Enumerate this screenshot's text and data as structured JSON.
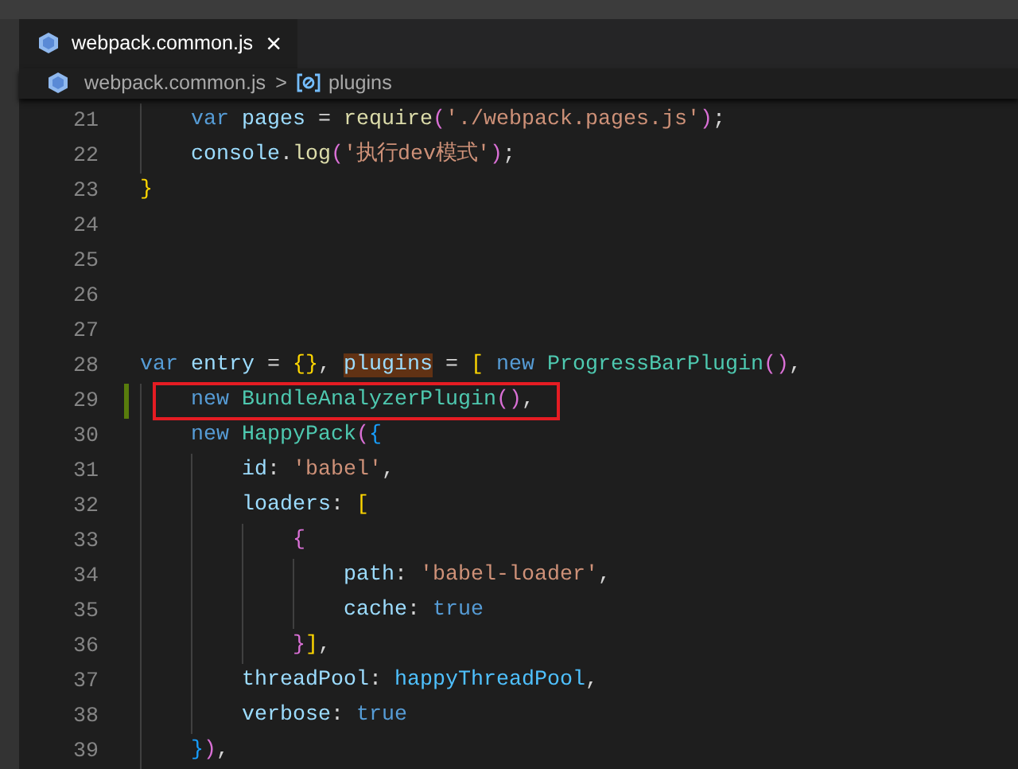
{
  "tab": {
    "label": "webpack.common.js",
    "close": "×",
    "selected": true
  },
  "breadcrumb": {
    "file": "webpack.common.js",
    "separator": ">",
    "symbol": "plugins"
  },
  "lines": [
    {
      "number": "21",
      "modified": false,
      "boxed": false,
      "tokens": [
        {
          "text": "    var ",
          "kind": "keyword"
        },
        {
          "text": "pages",
          "kind": "variable"
        },
        {
          "text": " = ",
          "kind": "plain"
        },
        {
          "text": "require",
          "kind": "function"
        },
        {
          "text": "(",
          "kind": "bracket2"
        },
        {
          "text": "'./webpack.pages.js'",
          "kind": "string"
        },
        {
          "text": ")",
          "kind": "bracket2"
        },
        {
          "text": ";",
          "kind": "plain"
        }
      ]
    },
    {
      "number": "22",
      "modified": false,
      "boxed": false,
      "tokens": [
        {
          "text": "    console",
          "kind": "variable"
        },
        {
          "text": ".",
          "kind": "plain"
        },
        {
          "text": "log",
          "kind": "function"
        },
        {
          "text": "(",
          "kind": "bracket2"
        },
        {
          "text": "'执行dev模式'",
          "kind": "string"
        },
        {
          "text": ")",
          "kind": "bracket2"
        },
        {
          "text": ";",
          "kind": "plain"
        }
      ]
    },
    {
      "number": "23",
      "modified": false,
      "boxed": false,
      "tokens": [
        {
          "text": "}",
          "kind": "bracket1"
        }
      ]
    },
    {
      "number": "24",
      "modified": false,
      "boxed": false
    },
    {
      "number": "25",
      "modified": false,
      "boxed": false
    },
    {
      "number": "26",
      "modified": false,
      "boxed": false
    },
    {
      "number": "27",
      "modified": false,
      "boxed": false
    },
    {
      "number": "28",
      "modified": false,
      "boxed": false,
      "tokens": [
        {
          "text": "var ",
          "kind": "keyword"
        },
        {
          "text": "entry",
          "kind": "variable"
        },
        {
          "text": " = ",
          "kind": "plain"
        },
        {
          "text": "{}",
          "kind": "bracket1"
        },
        {
          "text": ", ",
          "kind": "plain"
        },
        {
          "text": "plugins",
          "kind": "highlight"
        },
        {
          "text": " = ",
          "kind": "plain"
        },
        {
          "text": "[ ",
          "kind": "bracket1"
        },
        {
          "text": "new ",
          "kind": "keyword"
        },
        {
          "text": "ProgressBarPlugin",
          "kind": "class"
        },
        {
          "text": "()",
          "kind": "bracket2"
        },
        {
          "text": ",",
          "kind": "plain"
        }
      ]
    },
    {
      "number": "29",
      "modified": true,
      "boxed": true,
      "tokens": [
        {
          "text": "    new ",
          "kind": "keyword"
        },
        {
          "text": "BundleAnalyzerPlugin",
          "kind": "class"
        },
        {
          "text": "()",
          "kind": "bracket2"
        },
        {
          "text": ",",
          "kind": "plain"
        }
      ]
    },
    {
      "number": "30",
      "modified": false,
      "boxed": false,
      "tokens": [
        {
          "text": "    new ",
          "kind": "keyword"
        },
        {
          "text": "HappyPack",
          "kind": "class"
        },
        {
          "text": "(",
          "kind": "bracket2"
        },
        {
          "text": "{",
          "kind": "bracket3"
        }
      ]
    },
    {
      "number": "31",
      "modified": false,
      "boxed": false,
      "tokens": [
        {
          "text": "        id",
          "kind": "variable"
        },
        {
          "text": ": ",
          "kind": "plain"
        },
        {
          "text": "'babel'",
          "kind": "string"
        },
        {
          "text": ",",
          "kind": "plain"
        }
      ]
    },
    {
      "number": "32",
      "modified": false,
      "boxed": false,
      "tokens": [
        {
          "text": "        loaders",
          "kind": "variable"
        },
        {
          "text": ": ",
          "kind": "plain"
        },
        {
          "text": "[",
          "kind": "bracket1"
        }
      ]
    },
    {
      "number": "33",
      "modified": false,
      "boxed": false,
      "tokens": [
        {
          "text": "            {",
          "kind": "bracket2"
        }
      ]
    },
    {
      "number": "34",
      "modified": false,
      "boxed": false,
      "tokens": [
        {
          "text": "                path",
          "kind": "variable"
        },
        {
          "text": ": ",
          "kind": "plain"
        },
        {
          "text": "'babel-loader'",
          "kind": "string"
        },
        {
          "text": ",",
          "kind": "plain"
        }
      ]
    },
    {
      "number": "35",
      "modified": false,
      "boxed": false,
      "tokens": [
        {
          "text": "                cache",
          "kind": "variable"
        },
        {
          "text": ": ",
          "kind": "plain"
        },
        {
          "text": "true",
          "kind": "keyword"
        }
      ]
    },
    {
      "number": "36",
      "modified": false,
      "boxed": false,
      "tokens": [
        {
          "text": "            }",
          "kind": "bracket2"
        },
        {
          "text": "]",
          "kind": "bracket1"
        },
        {
          "text": ",",
          "kind": "plain"
        }
      ]
    },
    {
      "number": "37",
      "modified": false,
      "boxed": false,
      "tokens": [
        {
          "text": "        threadPool",
          "kind": "variable"
        },
        {
          "text": ": ",
          "kind": "plain"
        },
        {
          "text": "happyThreadPool",
          "kind": "constant"
        },
        {
          "text": ",",
          "kind": "plain"
        }
      ]
    },
    {
      "number": "38",
      "modified": false,
      "boxed": false,
      "tokens": [
        {
          "text": "        verbose",
          "kind": "variable"
        },
        {
          "text": ": ",
          "kind": "plain"
        },
        {
          "text": "true",
          "kind": "keyword"
        }
      ]
    },
    {
      "number": "39",
      "modified": false,
      "boxed": false,
      "tokens": [
        {
          "text": "    }",
          "kind": "bracket3"
        },
        {
          "text": ")",
          "kind": "bracket2"
        },
        {
          "text": ",",
          "kind": "plain"
        }
      ]
    }
  ]
}
